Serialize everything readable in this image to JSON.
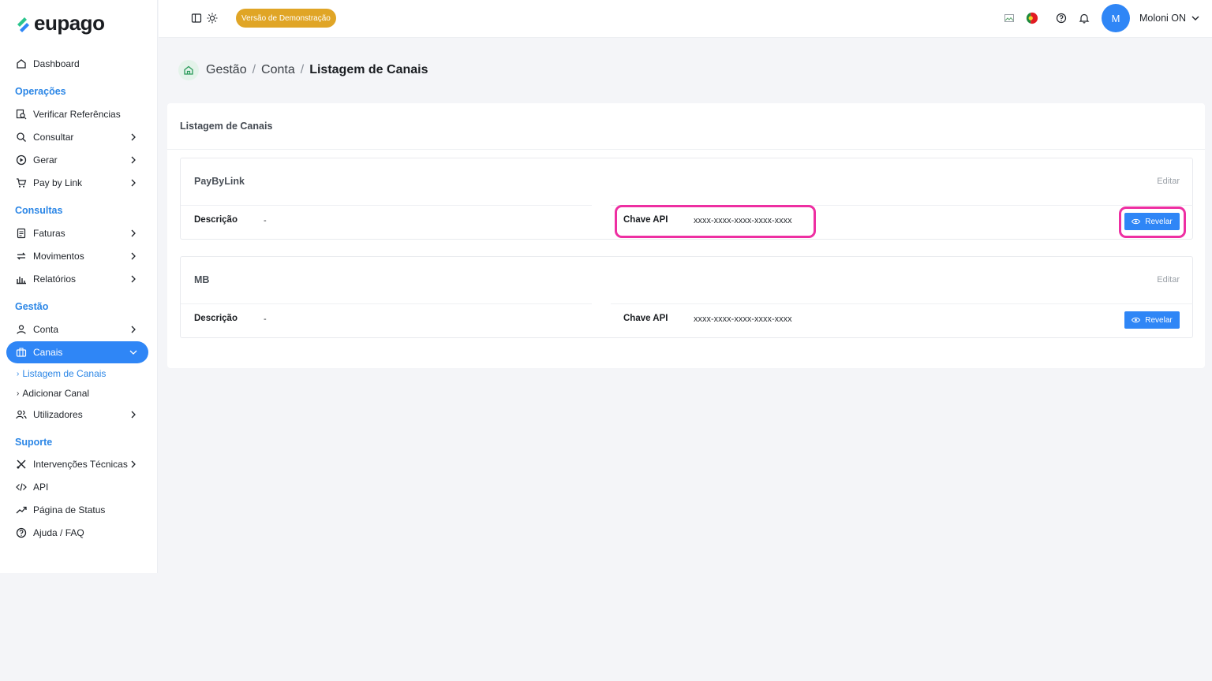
{
  "brand": {
    "name": "eupago",
    "accent": "#2f86f6",
    "section_color": "#2b86e6",
    "highlight": "#ee2fa2"
  },
  "sidebar": {
    "dashboard": "Dashboard",
    "sections": {
      "operacoes": "Operações",
      "consultas": "Consultas",
      "gestao": "Gestão",
      "suporte": "Suporte"
    },
    "items": {
      "verificar": "Verificar Referências",
      "consultar": "Consultar",
      "gerar": "Gerar",
      "paybylink": "Pay by Link",
      "faturas": "Faturas",
      "movimentos": "Movimentos",
      "relatorios": "Relatórios",
      "conta": "Conta",
      "canais": "Canais",
      "listagem": "Listagem de Canais",
      "adicionar": "Adicionar Canal",
      "utilizadores": "Utilizadores",
      "intervencoes": "Intervenções Técnicas",
      "api": "API",
      "status": "Página de Status",
      "ajuda": "Ajuda / FAQ"
    }
  },
  "topbar": {
    "demo_badge": "Versão de Demonstração",
    "avatar_initial": "M",
    "user_name": "Moloni ON"
  },
  "breadcrumb": {
    "level1": "Gestão",
    "level2": "Conta",
    "current": "Listagem de Canais"
  },
  "main": {
    "card_title": "Listagem de Canais",
    "channels": [
      {
        "name": "PayByLink",
        "edit": "Editar",
        "desc_label": "Descrição",
        "desc_value": "-",
        "key_label": "Chave API",
        "key_value": "xxxx-xxxx-xxxx-xxxx-xxxx",
        "reveal": "Revelar"
      },
      {
        "name": "MB",
        "edit": "Editar",
        "desc_label": "Descrição",
        "desc_value": "-",
        "key_label": "Chave API",
        "key_value": "xxxx-xxxx-xxxx-xxxx-xxxx",
        "reveal": "Revelar"
      }
    ]
  }
}
